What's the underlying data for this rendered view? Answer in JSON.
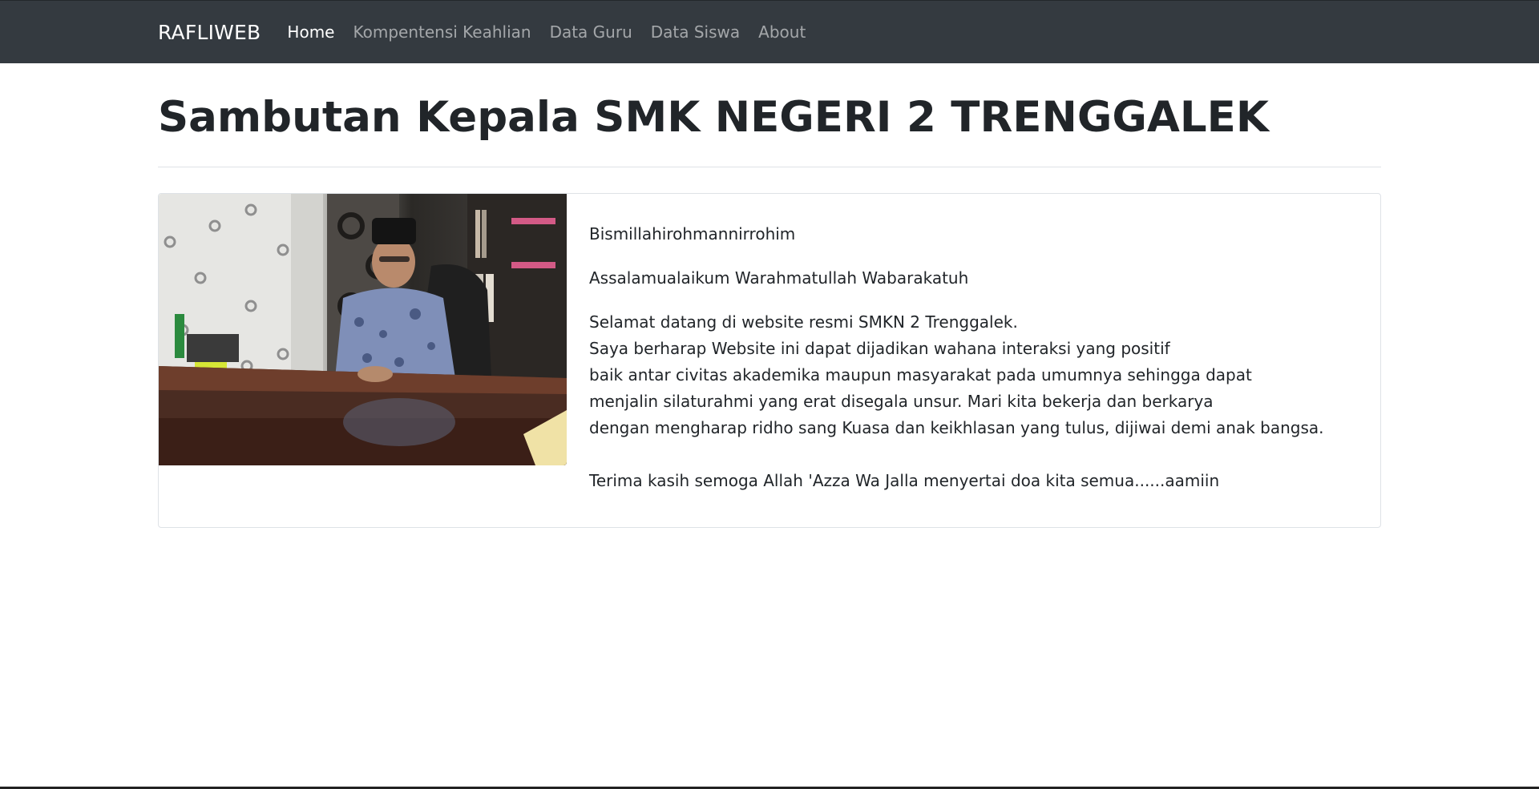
{
  "navbar": {
    "brand": "RAFLIWEB",
    "links": [
      {
        "label": "Home",
        "active": true
      },
      {
        "label": "Kompentensi Keahlian",
        "active": false
      },
      {
        "label": "Data Guru",
        "active": false
      },
      {
        "label": "Data Siswa",
        "active": false
      },
      {
        "label": "About",
        "active": false
      }
    ]
  },
  "page": {
    "title": "Sambutan Kepala SMK NEGERI 2 TRENGGALEK"
  },
  "welcome": {
    "opening": "Bismillahirohmannirrohim",
    "greeting": "Assalamualaikum Warahmatullah Wabarakatuh",
    "lines": [
      "Selamat datang di website resmi SMKN 2 Trenggalek.",
      "Saya berharap Website ini dapat dijadikan wahana interaksi yang positif",
      "baik antar civitas akademika maupun masyarakat pada umumnya sehingga dapat",
      "menjalin silaturahmi yang erat disegala unsur. Mari kita bekerja dan berkarya",
      "dengan mengharap ridho sang Kuasa dan keikhlasan yang tulus, dijiwai demi anak bangsa."
    ],
    "closing": "Terima kasih semoga Allah 'Azza Wa Jalla menyertai doa kita semua......aamiin"
  },
  "colors": {
    "navbar_bg": "#343a40",
    "text": "#212529",
    "border": "#dee2e6"
  }
}
